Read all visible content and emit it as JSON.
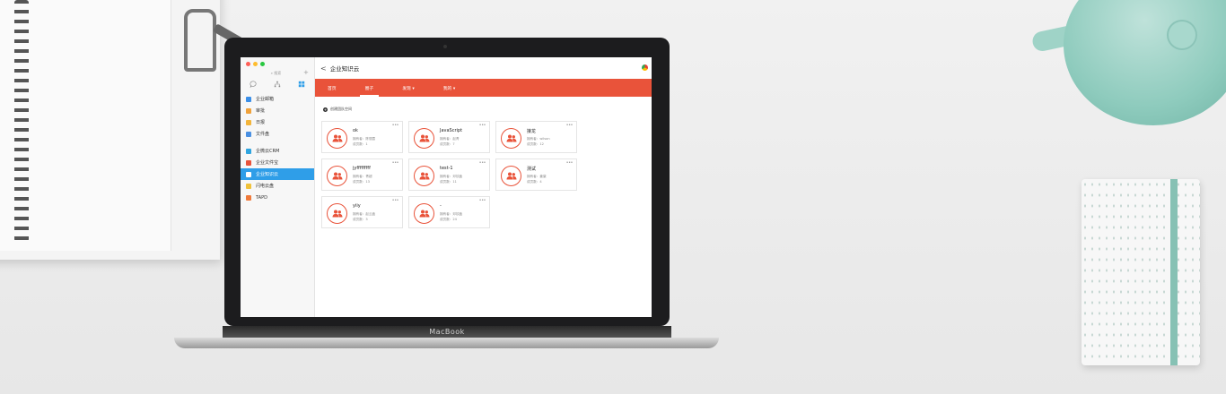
{
  "device": {
    "brand": "MacBook"
  },
  "sidebar": {
    "search_placeholder": "搜索",
    "add_symbol": "+",
    "window_dots": [
      "#ff5f57",
      "#febc2e",
      "#28c840"
    ],
    "nav_icons": [
      "chat-icon",
      "org-icon",
      "apps-icon"
    ],
    "items": [
      {
        "label": "企业邮箱",
        "icon": "mail-icon",
        "color": "#3b8fe8"
      },
      {
        "label": "审批",
        "icon": "approval-icon",
        "color": "#f0a23b"
      },
      {
        "label": "日报",
        "icon": "report-icon",
        "color": "#f3b53b"
      },
      {
        "label": "文件盘",
        "icon": "file-icon",
        "color": "#4a90e2"
      },
      {
        "label": "企微云CRM",
        "icon": "crm-icon",
        "color": "#2fa5e0"
      },
      {
        "label": "企业文件宝",
        "icon": "file-box-icon",
        "color": "#e9533a"
      },
      {
        "label": "企业知识云",
        "icon": "knowledge-icon",
        "color": "#ffffff",
        "active": true
      },
      {
        "label": "闪电云盘",
        "icon": "cloud-icon",
        "color": "#f0c23b"
      },
      {
        "label": "TAPD",
        "icon": "tapd-icon",
        "color": "#f07a3b"
      }
    ]
  },
  "header": {
    "back_symbol": "<",
    "title": "企业知识云"
  },
  "tabs": [
    {
      "label": "首页",
      "active": false
    },
    {
      "label": "圈子",
      "active": true
    },
    {
      "label": "发现 ▾",
      "active": false
    },
    {
      "label": "我的 ▾",
      "active": false
    }
  ],
  "actions": {
    "create_label": "创建团队空间"
  },
  "accent": "#e9533a",
  "cards": [
    {
      "name": "ok",
      "owner": "拥有者：陈丽霞",
      "members": "成员数：1"
    },
    {
      "name": "JavaScript",
      "owner": "拥有者：赵青",
      "members": "成员数：7"
    },
    {
      "name": "接龙",
      "owner": "拥有者：wilson",
      "members": "成员数：12"
    },
    {
      "name": "jyfffffffff",
      "owner": "拥有者：青超",
      "members": "成员数：13"
    },
    {
      "name": "test-1",
      "owner": "拥有者：邓钦鑫",
      "members": "成员数：11"
    },
    {
      "name": "测试",
      "owner": "拥有者：姜豪",
      "members": "成员数：4"
    },
    {
      "name": "yiiy",
      "owner": "拥有者：赵云鑫",
      "members": "成员数：3"
    },
    {
      "name": "-",
      "owner": "拥有者：邓钦鑫",
      "members": "成员数：24"
    }
  ]
}
